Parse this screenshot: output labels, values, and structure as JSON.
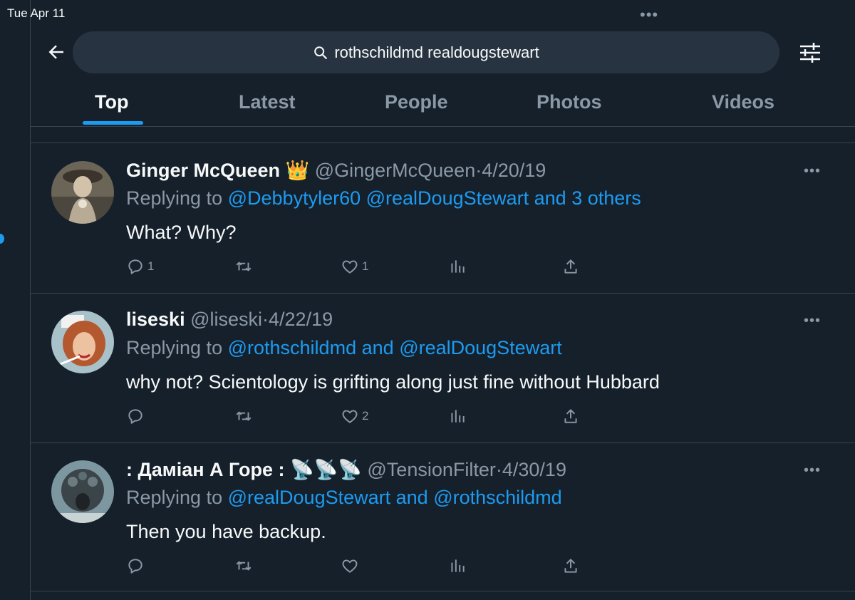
{
  "status_bar": {
    "time": "Tue Apr 11"
  },
  "search": {
    "query": "rothschildmd realdougstewart"
  },
  "tabs": [
    {
      "label": "Top",
      "active": true
    },
    {
      "label": "Latest"
    },
    {
      "label": "People"
    },
    {
      "label": "Photos"
    },
    {
      "label": "Videos"
    }
  ],
  "colors": {
    "background": "#15202b",
    "accent": "#1d9bf0",
    "muted": "#8b98a5",
    "search_bg": "#273340",
    "border": "#38444d"
  },
  "tweets": [
    {
      "name": "Ginger McQueen",
      "badge": "👑",
      "handle": "@GingerMcQueen",
      "separator": "·",
      "date": "4/20/19",
      "replying_prefix": "Replying to",
      "replying_1": "@Debbytyler60",
      "replying_2": "@realDougStewart and 3 others",
      "text": "What? Why?",
      "replies": "1",
      "retweets": "",
      "likes": "1"
    },
    {
      "name": "liseski",
      "handle": "@liseski",
      "separator": "·",
      "date": "4/22/19",
      "replying_prefix": "Replying to",
      "replying_1": "@rothschildmd",
      "replying_and": "and",
      "replying_2": "@realDougStewart",
      "text": "why not? Scientology is grifting along just fine without Hubbard",
      "replies": "",
      "retweets": "",
      "likes": "2"
    },
    {
      "name": ": Даміан А Горе :",
      "badge": "📡📡📡",
      "handle": "@TensionFilter",
      "separator": "·",
      "date": "4/30/19",
      "replying_prefix": "Replying to",
      "replying_1": "@realDougStewart",
      "replying_and": "and",
      "replying_2": "@rothschildmd",
      "text": "Then you have backup.",
      "replies": "",
      "retweets": "",
      "likes": ""
    }
  ],
  "icons": [
    "back-arrow-icon",
    "search-icon",
    "filter-sliders-icon",
    "reply-icon",
    "retweet-icon",
    "like-icon",
    "views-icon",
    "share-icon",
    "more-icon"
  ]
}
